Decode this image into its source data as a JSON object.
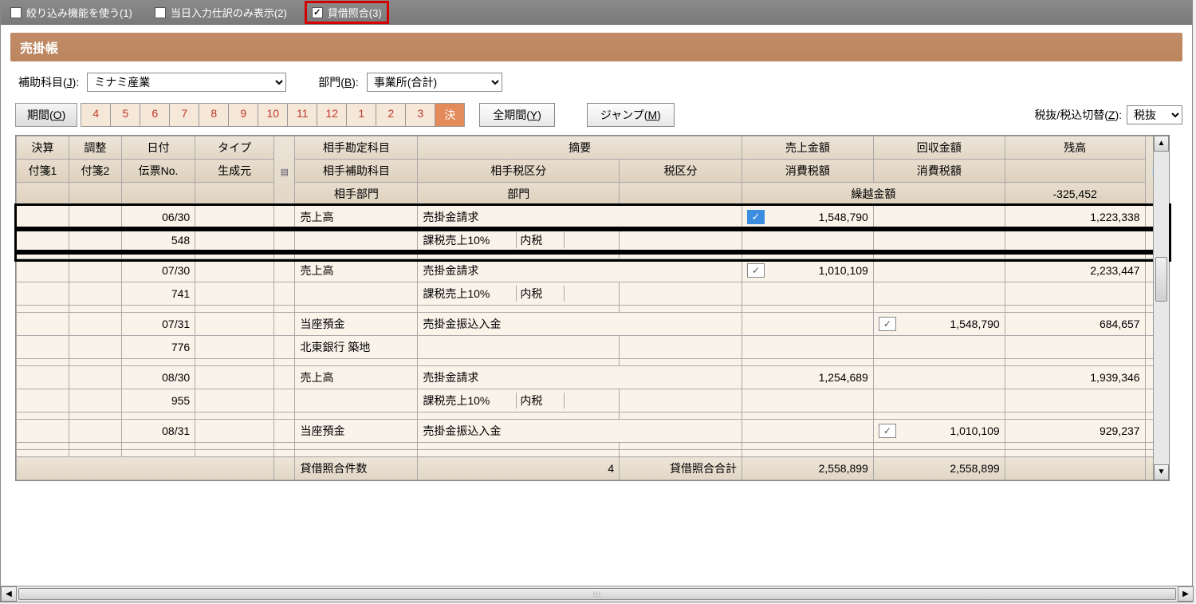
{
  "topbar": {
    "filter1_label": "絞り込み機能を使う(1)",
    "filter2_label": "当日入力仕訳のみ表示(2)",
    "filter3_label": "貸借照合(3)",
    "filter1_checked": false,
    "filter2_checked": false,
    "filter3_checked": true
  },
  "title": "売掛帳",
  "filters": {
    "sub_account_label": "補助科目(J):",
    "sub_account_value": "ミナミ産業",
    "dept_label": "部門(B):",
    "dept_value": "事業所(合計)"
  },
  "period": {
    "btn": "期間(O)",
    "months": [
      "4",
      "5",
      "6",
      "7",
      "8",
      "9",
      "10",
      "11",
      "12",
      "1",
      "2",
      "3",
      "決"
    ],
    "selected": "決",
    "all_btn": "全期間(Y)",
    "jump_btn": "ジャンプ(M)"
  },
  "tax": {
    "label": "税抜/税込切替(Z):",
    "value": "税抜"
  },
  "headers": {
    "r1": [
      "決算",
      "調整",
      "日付",
      "タイプ",
      "",
      "相手勘定科目",
      "摘要",
      "売上金額",
      "回収金額",
      "残高",
      ""
    ],
    "r2": [
      "付箋1",
      "付箋2",
      "伝票No.",
      "生成元",
      "",
      "相手補助科目",
      "相手税区分",
      "税区分",
      "消費税額",
      "消費税額",
      "",
      ""
    ],
    "r3": [
      "",
      "",
      "",
      "",
      "",
      "相手部門",
      "部門",
      "",
      "繰越金額",
      "-325,452",
      ""
    ]
  },
  "rows": [
    {
      "selected": true,
      "date": "06/30",
      "slip": "548",
      "aite1": "売上高",
      "aite2": "",
      "tekiyo1": "売掛金請求",
      "tax_kubun": "課税売上10%",
      "tax_inner": "内税",
      "chk": "blue",
      "uria": "1,548,790",
      "kaishu": "",
      "zan": "1,223,338"
    },
    {
      "date": "07/30",
      "slip": "741",
      "aite1": "売上高",
      "aite2": "",
      "tekiyo1": "売掛金請求",
      "tax_kubun": "課税売上10%",
      "tax_inner": "内税",
      "chk": "outline",
      "uria": "1,010,109",
      "kaishu": "",
      "zan": "2,233,447"
    },
    {
      "date": "07/31",
      "slip": "776",
      "aite1": "当座預金",
      "aite2": "北東銀行 築地",
      "tekiyo1": "売掛金振込入金",
      "tax_kubun": "",
      "tax_inner": "",
      "chk_r": "outline",
      "uria": "",
      "kaishu": "1,548,790",
      "zan": "684,657"
    },
    {
      "date": "08/30",
      "slip": "955",
      "aite1": "売上高",
      "aite2": "",
      "tekiyo1": "売掛金請求",
      "tax_kubun": "課税売上10%",
      "tax_inner": "内税",
      "chk": "",
      "uria": "1,254,689",
      "kaishu": "",
      "zan": "1,939,346"
    },
    {
      "date": "08/31",
      "slip": "",
      "aite1": "当座預金",
      "aite2": "",
      "tekiyo1": "売掛金振込入金",
      "tax_kubun": "",
      "tax_inner": "",
      "chk_r": "outline",
      "uria": "",
      "kaishu": "1,010,109",
      "zan": "929,237"
    }
  ],
  "footer": {
    "count_label": "貸借照合件数",
    "count": "4",
    "total_label": "貸借照合合計",
    "uria_total": "2,558,899",
    "kaishu_total": "2,558,899"
  }
}
